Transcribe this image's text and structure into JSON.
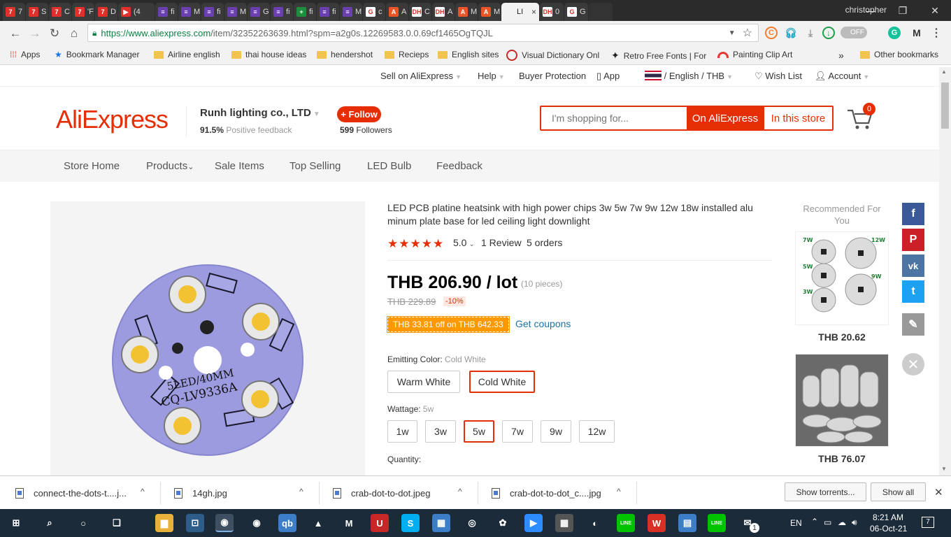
{
  "browser": {
    "tabs": [
      {
        "label": "7",
        "color": "#e0302b",
        "glyph": "7"
      },
      {
        "label": "S",
        "color": "#e0302b",
        "glyph": "7"
      },
      {
        "label": "C",
        "color": "#e0302b",
        "glyph": "7"
      },
      {
        "label": "'F",
        "color": "#e0302b",
        "glyph": "7"
      },
      {
        "label": "D",
        "color": "#e0302b",
        "glyph": "7"
      },
      {
        "label": "(4",
        "color": "#e0302b",
        "glyph": "▶"
      },
      {
        "label": "fi",
        "color": "#6a3fb0",
        "glyph": "≡"
      },
      {
        "label": "M",
        "color": "#6a3fb0",
        "glyph": "≡"
      },
      {
        "label": "fi",
        "color": "#6a3fb0",
        "glyph": "≡"
      },
      {
        "label": "M",
        "color": "#6a3fb0",
        "glyph": "≡"
      },
      {
        "label": "G",
        "color": "#6a3fb0",
        "glyph": "≡"
      },
      {
        "label": "fi",
        "color": "#6a3fb0",
        "glyph": "≡"
      },
      {
        "label": "fi",
        "color": "#1e8e3e",
        "glyph": "+"
      },
      {
        "label": "fi",
        "color": "#6a3fb0",
        "glyph": "≡"
      },
      {
        "label": "M",
        "color": "#6a3fb0",
        "glyph": "≡"
      },
      {
        "label": "c",
        "color": "#ffffff",
        "glyph": "G"
      },
      {
        "label": "A",
        "color": "#e8552a",
        "glyph": "A"
      },
      {
        "label": "C",
        "color": "#ffffff",
        "glyph": "DH"
      },
      {
        "label": "A",
        "color": "#ffffff",
        "glyph": "DH"
      },
      {
        "label": "M",
        "color": "#e8552a",
        "glyph": "A"
      },
      {
        "label": "M",
        "color": "#e8552a",
        "glyph": "A"
      },
      {
        "label": "LI",
        "color": "#f2f2f2",
        "glyph": "",
        "active": true
      },
      {
        "label": "0",
        "color": "#ffffff",
        "glyph": "DH"
      },
      {
        "label": "G",
        "color": "#ffffff",
        "glyph": "G"
      }
    ],
    "tab_close": "×",
    "user": "christopher",
    "window_controls": [
      "—",
      "❐",
      "✕"
    ],
    "url_host": "https://www.aliexpress.com",
    "url_path": "/item/32352263639.html?spm=a2g0s.12269583.0.0.69cf1465OgTQJL",
    "toggle_label": "OFF",
    "bookmarks": [
      {
        "label": "Apps",
        "icon": "apps-icon"
      },
      {
        "label": "Bookmark Manager",
        "icon": "star-icon"
      },
      {
        "label": "Airline english",
        "icon": "folder-icon"
      },
      {
        "label": "thai house ideas",
        "icon": "folder-icon"
      },
      {
        "label": "hendershot",
        "icon": "folder-icon"
      },
      {
        "label": "Recieps",
        "icon": "folder-icon"
      },
      {
        "label": "English sites",
        "icon": "folder-icon"
      },
      {
        "label": "Visual Dictionary Onl",
        "icon": "globe-icon"
      },
      {
        "label": "Retro Free Fonts | For",
        "icon": "logo-icon"
      },
      {
        "label": "Painting Clip Art",
        "icon": "rainbow-icon"
      }
    ],
    "bookmarks_overflow": "»",
    "other_bookmarks": "Other bookmarks"
  },
  "topbar": {
    "sell": "Sell on AliExpress",
    "help": "Help",
    "buyer_protection": "Buyer Protection",
    "app": "App",
    "language": "/ English /  THB",
    "wishlist": "Wish List",
    "account": "Account"
  },
  "store": {
    "logo": "AliExpress",
    "name": "Runh lighting co., LTD",
    "feedback_pct": "91.5%",
    "feedback_label": "Positive feedback",
    "follow_label": "+ Follow",
    "followers_count": "599",
    "followers_label": "Followers",
    "search_placeholder": "I'm shopping for...",
    "on_aliexpress": "On AliExpress",
    "in_this_store": "In this store",
    "cart_count": "0",
    "nav": [
      "Store Home",
      "Products",
      "Sale Items",
      "Top Selling",
      "LED Bulb",
      "Feedback"
    ]
  },
  "product": {
    "title": "LED PCB platine heatsink with high power chips 3w 5w 7w 9w 12w 18w installed alu minum plate base for led ceiling light downlight",
    "stars": "★★★★★",
    "rating": "5.0",
    "rating_caret": "⌄",
    "reviews": "1 Review",
    "orders": "5 orders",
    "price": "THB 206.90 / lot",
    "pieces": "(10 pieces)",
    "old_price": "THB 229.89",
    "discount": "-10%",
    "coupon": "THB 33.81 off on THB 642.33",
    "get_coupons": "Get coupons",
    "color_label": "Emitting Color:",
    "color_value": "Cold White",
    "colors": [
      {
        "label": "Warm White",
        "selected": false
      },
      {
        "label": "Cold White",
        "selected": true
      }
    ],
    "wattage_label": "Wattage:",
    "wattage_value": "5w",
    "wattages": [
      {
        "label": "1w",
        "selected": false
      },
      {
        "label": "3w",
        "selected": false
      },
      {
        "label": "5w",
        "selected": true
      },
      {
        "label": "7w",
        "selected": false
      },
      {
        "label": "9w",
        "selected": false
      },
      {
        "label": "12w",
        "selected": false
      }
    ],
    "quantity_label": "Quantity:",
    "pcb_label_1": "5LED/40MM",
    "pcb_label_2": "CQ-LV9336A"
  },
  "recommended": {
    "title": "Recommended For You",
    "items": [
      {
        "price": "THB 20.62",
        "labels": [
          "7W",
          "12W",
          "5W",
          "9W",
          "3W"
        ]
      },
      {
        "price": "THB 76.07"
      }
    ]
  },
  "social": [
    {
      "name": "facebook-icon",
      "glyph": "f",
      "color": "#3b5998"
    },
    {
      "name": "pinterest-icon",
      "glyph": "P",
      "color": "#cb2027"
    },
    {
      "name": "vk-icon",
      "glyph": "vk",
      "color": "#4c75a3"
    },
    {
      "name": "twitter-icon",
      "glyph": "t",
      "color": "#1da1f2"
    },
    {
      "name": "edit-icon",
      "glyph": "✎",
      "color": "#999999"
    }
  ],
  "social_close": "✕",
  "downloads": {
    "files": [
      "connect-the-dots-t....j...",
      "14gh.jpg",
      "crab-dot-to-dot.jpeg",
      "crab-dot-to-dot_c....jpg"
    ],
    "caret": "^",
    "show_torrents": "Show torrents...",
    "show_all": "Show all",
    "close": "✕"
  },
  "taskbar": {
    "apps": [
      {
        "name": "start-icon",
        "glyph": "⊞",
        "color": "#1c2b3a"
      },
      {
        "name": "search-icon",
        "glyph": "⌕",
        "color": "#1c2b3a"
      },
      {
        "name": "cortana-icon",
        "glyph": "○",
        "color": "#1c2b3a"
      },
      {
        "name": "task-view-icon",
        "glyph": "❏",
        "color": "#1c2b3a"
      },
      {
        "name": "file-explorer-icon",
        "glyph": "▆",
        "color": "#e8b23a"
      },
      {
        "name": "store-icon",
        "glyph": "⊡",
        "color": "#2f5d8a"
      },
      {
        "name": "chrome-active-icon",
        "glyph": "◉",
        "color": "#3d4f60"
      },
      {
        "name": "chrome-icon",
        "glyph": "◉",
        "color": "#1c2b3a"
      },
      {
        "name": "qbittorrent-icon",
        "glyph": "qb",
        "color": "#3d7ec8"
      },
      {
        "name": "vlc-icon",
        "glyph": "▲",
        "color": "#1c2b3a"
      },
      {
        "name": "malwarebytes-icon",
        "glyph": "M",
        "color": "#1c2b3a"
      },
      {
        "name": "uninstaller-icon",
        "glyph": "U",
        "color": "#c62828"
      },
      {
        "name": "skype-icon",
        "glyph": "S",
        "color": "#00aff0"
      },
      {
        "name": "control-panel-icon",
        "glyph": "▦",
        "color": "#3d7ec8"
      },
      {
        "name": "media-icon",
        "glyph": "◎",
        "color": "#1c2b3a"
      },
      {
        "name": "paint-icon",
        "glyph": "✿",
        "color": "#1c2b3a"
      },
      {
        "name": "zoom-icon",
        "glyph": "▶",
        "color": "#2d8cff"
      },
      {
        "name": "calculator-icon",
        "glyph": "▦",
        "color": "#555555"
      },
      {
        "name": "obs-icon",
        "glyph": "◐",
        "color": "#1c2b3a"
      },
      {
        "name": "line-icon",
        "glyph": "LINE",
        "color": "#00c300"
      },
      {
        "name": "wps-icon",
        "glyph": "W",
        "color": "#d93025"
      },
      {
        "name": "printer-icon",
        "glyph": "▤",
        "color": "#3d7ec8"
      },
      {
        "name": "line2-icon",
        "glyph": "LINE",
        "color": "#00c300"
      },
      {
        "name": "mail-icon",
        "glyph": "✉",
        "color": "#1c2b3a"
      }
    ],
    "mail_badge": "1",
    "lang": "EN",
    "time": "8:21 AM",
    "date": "06-Oct-21",
    "notifications": "7"
  }
}
